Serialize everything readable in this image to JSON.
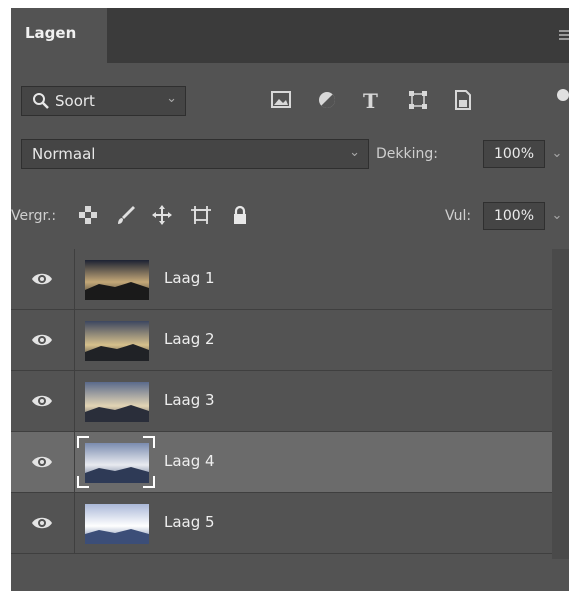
{
  "panel": {
    "tab_title": "Lagen"
  },
  "filter": {
    "kind_label": "Soort",
    "icons": [
      "image-filter-icon",
      "adjustment-filter-icon",
      "type-filter-icon",
      "shape-filter-icon",
      "smart-object-filter-icon"
    ]
  },
  "blend": {
    "mode": "Normaal",
    "opacity_label": "Dekking:",
    "opacity_value": "100%"
  },
  "lock": {
    "label": "Vergr.:",
    "icons": [
      "lock-transparent-pixels-icon",
      "lock-image-pixels-icon",
      "lock-position-icon",
      "lock-artboard-icon",
      "lock-all-icon"
    ],
    "fill_label": "Vul:",
    "fill_value": "100%"
  },
  "layers": [
    {
      "name": "Laag 1",
      "visible": true,
      "selected": false
    },
    {
      "name": "Laag 2",
      "visible": true,
      "selected": false
    },
    {
      "name": "Laag 3",
      "visible": true,
      "selected": false
    },
    {
      "name": "Laag 4",
      "visible": true,
      "selected": true
    },
    {
      "name": "Laag 5",
      "visible": true,
      "selected": false
    }
  ],
  "colors": {
    "panel_bg": "#535353",
    "selected_row": "#6b6b6b",
    "tab_bar": "#3b3b3b"
  }
}
